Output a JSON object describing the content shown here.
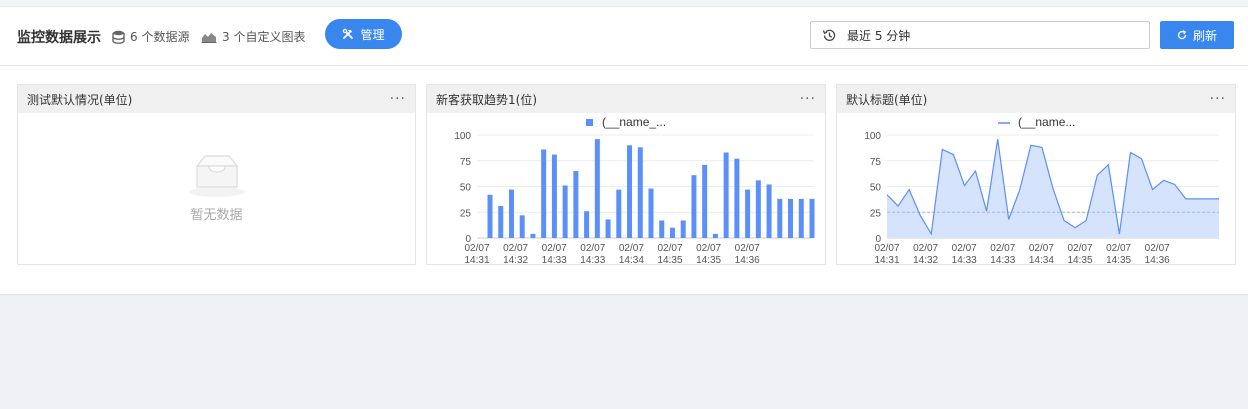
{
  "header": {
    "title": "监控数据展示",
    "datasource_count": "6 个数据源",
    "chart_count": "3 个自定义图表",
    "manage_label": "管理",
    "time_range": "最近 5 分钟",
    "refresh_label": "刷新"
  },
  "colors": {
    "accent": "#3a86ef",
    "bar": "#5b8ff9",
    "area_fill": "#d6e3fd",
    "line": "#5b8ff9"
  },
  "panels": [
    {
      "title": "测试默认情况(单位)",
      "more": "···",
      "empty_text": "暂无数据"
    },
    {
      "title": "新客获取趋势1(位)",
      "more": "···",
      "legend": "(__name_..."
    },
    {
      "title": "默认标题(单位)",
      "more": "···",
      "legend": "(__name..."
    }
  ],
  "chart_data": [
    {
      "type": "bar",
      "y_ticks": [
        "100",
        "75",
        "50",
        "25",
        "0"
      ],
      "ylim": [
        0,
        100
      ],
      "x_tick_labels": [
        {
          "date": "02/07",
          "time": "14:31"
        },
        {
          "date": "02/07",
          "time": "14:32"
        },
        {
          "date": "02/07",
          "time": "14:33"
        },
        {
          "date": "02/07",
          "time": "14:33"
        },
        {
          "date": "02/07",
          "time": "14:34"
        },
        {
          "date": "02/07",
          "time": "14:35"
        },
        {
          "date": "02/07",
          "time": "14:35"
        },
        {
          "date": "02/07",
          "time": "14:36"
        }
      ],
      "series": [
        {
          "name": "(__name_...",
          "values": [
            42,
            31,
            47,
            22,
            4,
            86,
            81,
            51,
            65,
            26,
            96,
            18,
            47,
            90,
            88,
            48,
            17,
            10,
            17,
            61,
            71,
            4,
            83,
            77,
            47,
            56,
            52,
            38,
            38,
            38,
            38
          ]
        }
      ]
    },
    {
      "type": "area",
      "y_ticks": [
        "100",
        "75",
        "50",
        "25",
        "0"
      ],
      "ylim": [
        0,
        100
      ],
      "x_tick_labels": [
        {
          "date": "02/07",
          "time": "14:31"
        },
        {
          "date": "02/07",
          "time": "14:32"
        },
        {
          "date": "02/07",
          "time": "14:33"
        },
        {
          "date": "02/07",
          "time": "14:33"
        },
        {
          "date": "02/07",
          "time": "14:34"
        },
        {
          "date": "02/07",
          "time": "14:35"
        },
        {
          "date": "02/07",
          "time": "14:35"
        },
        {
          "date": "02/07",
          "time": "14:36"
        }
      ],
      "series": [
        {
          "name": "(__name...",
          "values": [
            42,
            31,
            47,
            22,
            4,
            86,
            81,
            51,
            65,
            26,
            96,
            18,
            47,
            90,
            88,
            48,
            17,
            10,
            17,
            61,
            71,
            4,
            83,
            77,
            47,
            56,
            52,
            38,
            38,
            38,
            38
          ]
        }
      ]
    }
  ]
}
